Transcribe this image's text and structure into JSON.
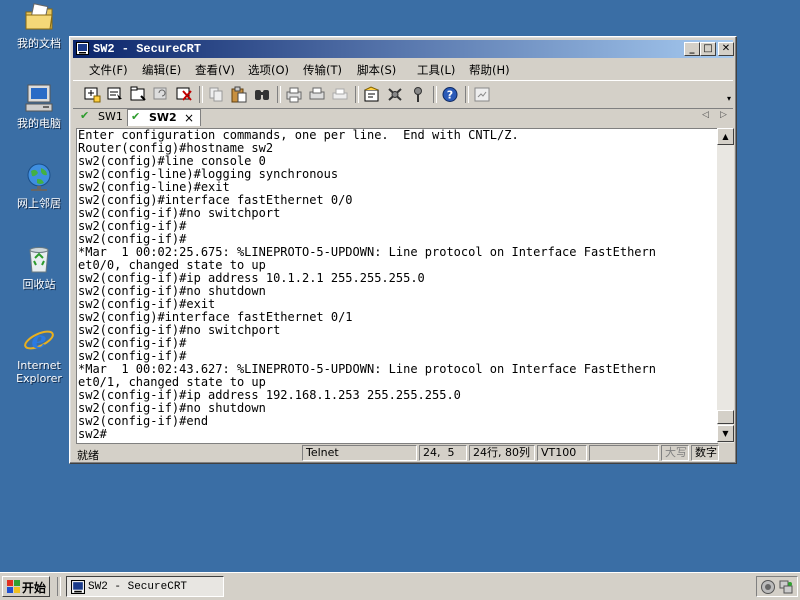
{
  "desktop": {
    "icons": [
      {
        "label": "我的文档",
        "icon": "my-documents-icon"
      },
      {
        "label": "我的电脑",
        "icon": "my-computer-icon"
      },
      {
        "label": "网上邻居",
        "icon": "network-places-icon"
      },
      {
        "label": "回收站",
        "icon": "recycle-bin-icon"
      },
      {
        "label": "Internet Explorer",
        "icon": "internet-explorer-icon"
      }
    ]
  },
  "window": {
    "title": "SW2 - SecureCRT",
    "controls": {
      "minimize": "_",
      "maximize": "□",
      "close": "✕"
    }
  },
  "menu": {
    "items": [
      {
        "label": "文件(F)"
      },
      {
        "label": "编辑(E)"
      },
      {
        "label": "查看(V)"
      },
      {
        "label": "选项(O)"
      },
      {
        "label": "传输(T)"
      },
      {
        "label": "脚本(S)"
      },
      {
        "label": "工具(L)"
      },
      {
        "label": "帮助(H)"
      }
    ]
  },
  "tabs": {
    "items": [
      {
        "label": "SW1",
        "active": false
      },
      {
        "label": "SW2",
        "active": true
      }
    ],
    "close": "×",
    "scroll_left": "◁",
    "scroll_right": "▷"
  },
  "terminal": {
    "text": "Enter configuration commands, one per line.  End with CNTL/Z.\nRouter(config)#hostname sw2\nsw2(config)#line console 0\nsw2(config-line)#logging synchronous\nsw2(config-line)#exit\nsw2(config)#interface fastEthernet 0/0\nsw2(config-if)#no switchport\nsw2(config-if)#\nsw2(config-if)#\n*Mar  1 00:02:25.675: %LINEPROTO-5-UPDOWN: Line protocol on Interface FastEthern\net0/0, changed state to up\nsw2(config-if)#ip address 10.1.2.1 255.255.255.0\nsw2(config-if)#no shutdown\nsw2(config-if)#exit\nsw2(config)#interface fastEthernet 0/1\nsw2(config-if)#no switchport\nsw2(config-if)#\nsw2(config-if)#\n*Mar  1 00:02:43.627: %LINEPROTO-5-UPDOWN: Line protocol on Interface FastEthern\net0/1, changed state to up\nsw2(config-if)#ip address 192.168.1.253 255.255.255.0\nsw2(config-if)#no shutdown\nsw2(config-if)#end\nsw2#"
  },
  "statusbar": {
    "ready": "就绪",
    "protocol": "Telnet",
    "cursor": "24,  5",
    "size": "24行, 80列",
    "emulation": "VT100",
    "blank": "",
    "caps": "大写",
    "num": "数字"
  },
  "taskbar": {
    "start": "开始",
    "task": "SW2 - SecureCRT"
  }
}
